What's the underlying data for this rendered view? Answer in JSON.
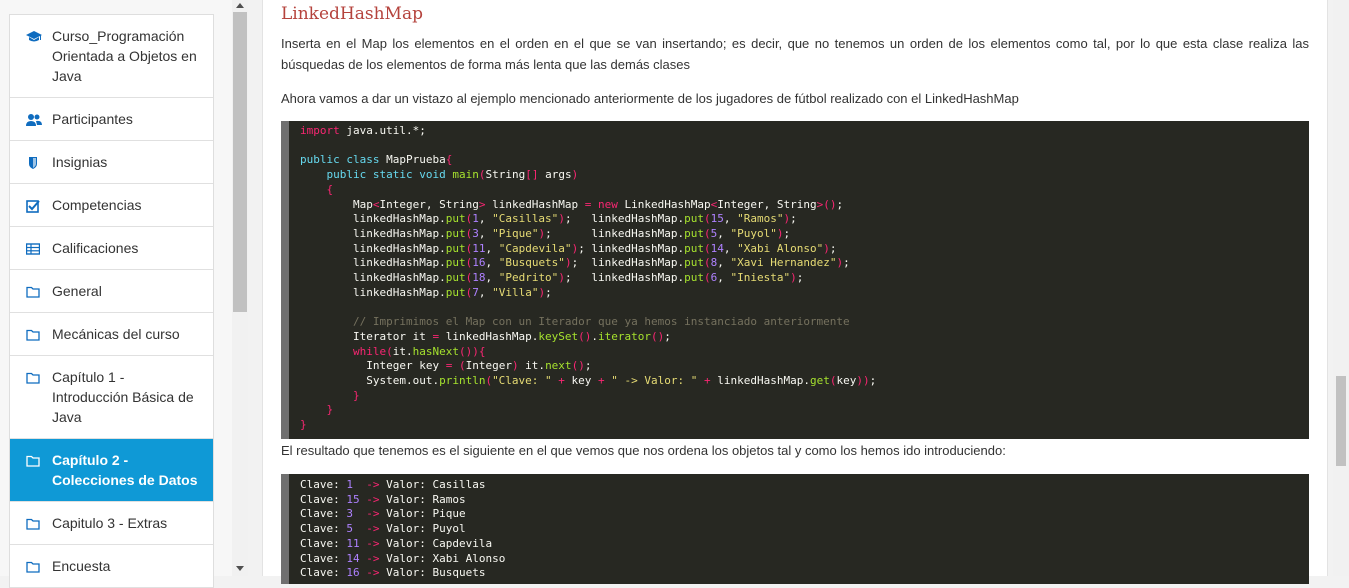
{
  "sidebar": {
    "items": [
      {
        "label": "Curso_Programación Orientada a Objetos en Java",
        "icon": "graduation-cap-icon"
      },
      {
        "label": "Participantes",
        "icon": "users-icon"
      },
      {
        "label": "Insignias",
        "icon": "shield-icon"
      },
      {
        "label": "Competencias",
        "icon": "checkbox-icon"
      },
      {
        "label": "Calificaciones",
        "icon": "table-icon"
      },
      {
        "label": "General",
        "icon": "folder-icon"
      },
      {
        "label": "Mecánicas del curso",
        "icon": "folder-icon"
      },
      {
        "label": "Capítulo 1 - Introducción Básica de Java",
        "icon": "folder-icon"
      },
      {
        "label": "Capítulo 2 - Colecciones de Datos",
        "icon": "folder-icon"
      },
      {
        "label": "Capitulo 3 - Extras",
        "icon": "folder-icon"
      },
      {
        "label": "Encuesta",
        "icon": "folder-icon"
      }
    ],
    "active_index": 8
  },
  "content": {
    "title": "LinkedHashMap",
    "paragraph1": "Inserta en el Map los elementos en el orden en el que se van insertando; es decir, que no tenemos un orden de los elementos como tal, por lo que esta clase realiza las búsquedas de los elementos de forma más lenta que las demás clases",
    "paragraph2": "Ahora vamos a dar un vistazo al ejemplo mencionado anteriormente de los jugadores de fútbol realizado con el LinkedHashMap",
    "paragraph3": "El resultado que tenemos es el siguiente en el que vemos que nos ordena los objetos tal y como los hemos ido introduciendo:",
    "code_lines": [
      "import java.util.*;",
      "",
      "public class MapPrueba{",
      "    public static void main(String[] args)",
      "    {",
      "        Map<Integer, String> linkedHashMap = new LinkedHashMap<Integer, String>();",
      "        linkedHashMap.put(1, \"Casillas\");   linkedHashMap.put(15, \"Ramos\");",
      "        linkedHashMap.put(3, \"Pique\");      linkedHashMap.put(5, \"Puyol\");",
      "        linkedHashMap.put(11, \"Capdevila\"); linkedHashMap.put(14, \"Xabi Alonso\");",
      "        linkedHashMap.put(16, \"Busquets\");  linkedHashMap.put(8, \"Xavi Hernandez\");",
      "        linkedHashMap.put(18, \"Pedrito\");   linkedHashMap.put(6, \"Iniesta\");",
      "        linkedHashMap.put(7, \"Villa\");",
      "",
      "        // Imprimimos el Map con un Iterador que ya hemos instanciado anteriormente",
      "        Iterator it = linkedHashMap.keySet().iterator();",
      "        while(it.hasNext()){",
      "          Integer key = (Integer) it.next();",
      "          System.out.println(\"Clave: \" + key + \" -> Valor: \" + linkedHashMap.get(key));",
      "        }",
      "    }",
      "}"
    ],
    "output_lines": [
      "Clave: 1  -> Valor: Casillas",
      "Clave: 15 -> Valor: Ramos",
      "Clave: 3  -> Valor: Pique",
      "Clave: 5  -> Valor: Puyol",
      "Clave: 11 -> Valor: Capdevila",
      "Clave: 14 -> Valor: Xabi Alonso",
      "Clave: 16 -> Valor: Busquets"
    ]
  },
  "colors": {
    "accent": "#0f99d6",
    "title": "#b5433d",
    "code_bg": "#272822"
  }
}
